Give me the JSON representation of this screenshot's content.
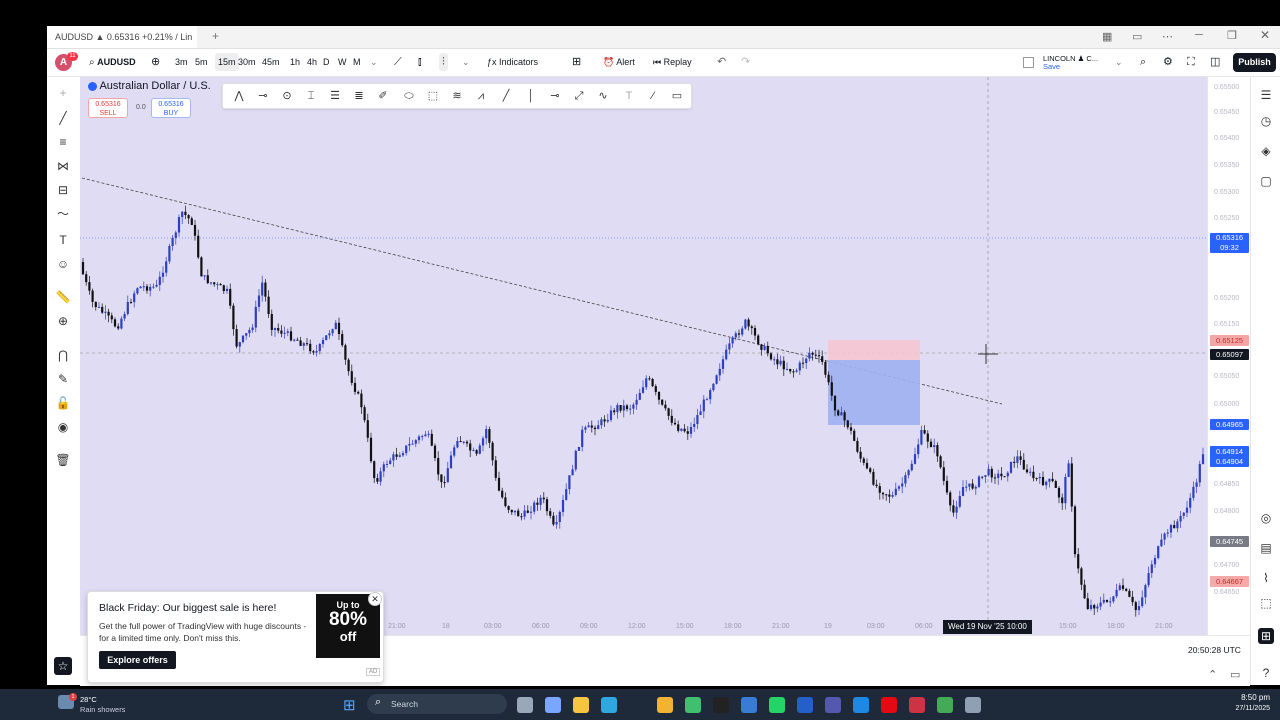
{
  "browser": {
    "tab_title": "AUDUSD ▲ 0.65316 +0.21% / Lin",
    "new_tab": "+"
  },
  "toolbar": {
    "avatar_letter": "A",
    "notif_count": "11",
    "symbol": "AUDUSD",
    "intervals": [
      "3m",
      "5m",
      "15m",
      "30m",
      "45m",
      "1h",
      "4h",
      "D",
      "W",
      "M"
    ],
    "selected_interval": "15m",
    "indicators_label": "Indicators",
    "alert_label": "Alert",
    "replay_label": "Replay",
    "layout_name": "LINCOLN ♟ C...",
    "layout_sub": "Save",
    "publish_label": "Publish"
  },
  "legend": {
    "title": "Australian Dollar / U.S.",
    "sell_price": "0.65316",
    "sell_label": "SELL",
    "spread": "0.0",
    "buy_price": "0.65316",
    "buy_label": "BUY"
  },
  "price_axis": {
    "labels": [
      "0.65500",
      "0.65450",
      "0.65400",
      "0.65350",
      "0.65300",
      "0.65250",
      "0.65200",
      "0.65150",
      "0.65050",
      "0.65000",
      "0.64850",
      "0.64800",
      "0.64700",
      "0.64650"
    ],
    "current_price": "0.65316",
    "countdown": "09:32",
    "tags": [
      {
        "value": "0.65125",
        "color": "#f4a6a6",
        "text_color": "#c23030"
      },
      {
        "value": "0.65097",
        "color": "#131722",
        "text_color": "#ffffff"
      },
      {
        "value": "0.64965",
        "color": "#2962ff",
        "text_color": "#ffffff"
      },
      {
        "value": "0.64914",
        "color": "#2962ff",
        "text_color": "#ffffff"
      },
      {
        "value": "0.64904",
        "color": "#2962ff",
        "text_color": "#ffffff"
      },
      {
        "value": "0.64745",
        "color": "#787b86",
        "text_color": "#ffffff"
      },
      {
        "value": "0.64667",
        "color": "#f7a8a8",
        "text_color": "#c23030"
      }
    ]
  },
  "time_axis": {
    "labels": [
      "21:00",
      "18",
      "03:00",
      "06:00",
      "09:00",
      "12:00",
      "15:00",
      "18:00",
      "21:00",
      "19",
      "03:00",
      "06:00",
      "15:00",
      "18:00",
      "21:00"
    ],
    "crosshair_label": "Wed 19 Nov '25   10:00",
    "clock": "20:50:28 UTC"
  },
  "promo": {
    "title": "Black Friday: Our biggest sale is here!",
    "body": "Get the full power of TradingView with huge discounts - for a limited time only. Don't miss this.",
    "cta": "Explore offers",
    "badge_top": "Up to",
    "badge_pct": "80%",
    "badge_off": "off",
    "ad_label": "AD"
  },
  "taskbar": {
    "weather_temp": "28°C",
    "weather_desc": "Rain showers",
    "search_placeholder": "Search",
    "time": "8:50 pm",
    "date": "27/11/2025"
  },
  "colors": {
    "chart_bg": "#e0dcf4",
    "bull": "#2e3fbf",
    "bear": "#111111",
    "accent": "#2962ff"
  }
}
